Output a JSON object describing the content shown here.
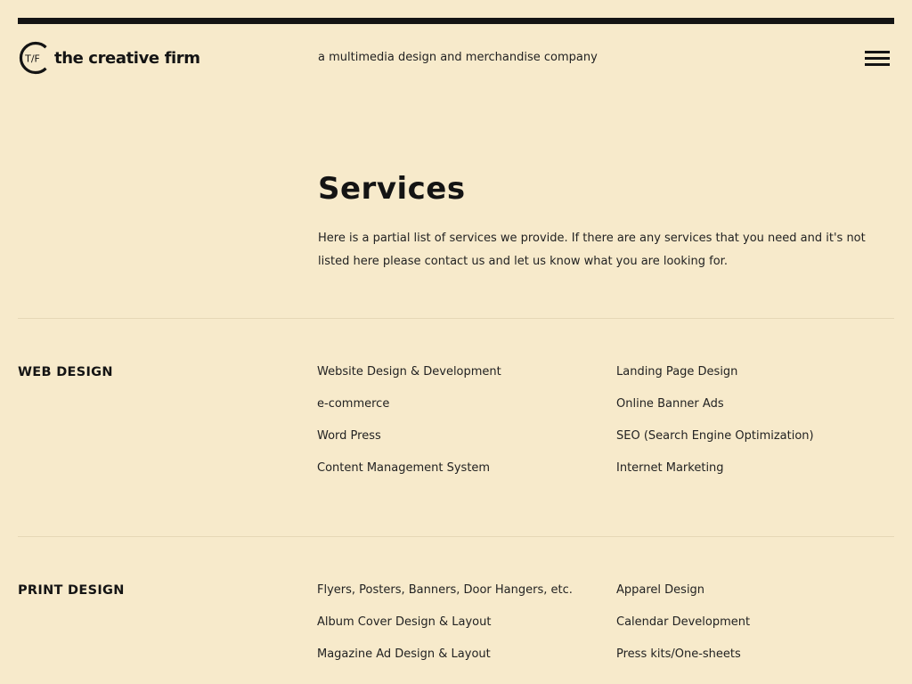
{
  "header": {
    "logo_text": "the creative firm",
    "logo_mark": "T/F",
    "tagline": "a multimedia design and merchandise company",
    "menu_icon": "hamburger-menu-icon"
  },
  "main": {
    "title": "Services",
    "intro": "Here is a partial list of services we provide. If there are any services that you need and it's not listed here please contact us and let us know what you are looking for."
  },
  "sections": [
    {
      "title": "WEB DESIGN",
      "col1": [
        "Website Design & Development",
        "e-commerce",
        "Word Press",
        "Content Management System"
      ],
      "col2": [
        "Landing Page Design",
        "Online Banner Ads",
        "SEO (Search Engine Optimization)",
        "Internet Marketing"
      ]
    },
    {
      "title": "PRINT DESIGN",
      "col1": [
        "Flyers, Posters, Banners, Door Hangers, etc.",
        "Album Cover Design & Layout",
        "Magazine Ad Design & Layout"
      ],
      "col2": [
        "Apparel Design",
        "Calendar Development",
        "Press kits/One-sheets"
      ]
    }
  ],
  "colors": {
    "background": "#f7eacb",
    "text": "#141414",
    "divider": "#e6d8b6"
  }
}
